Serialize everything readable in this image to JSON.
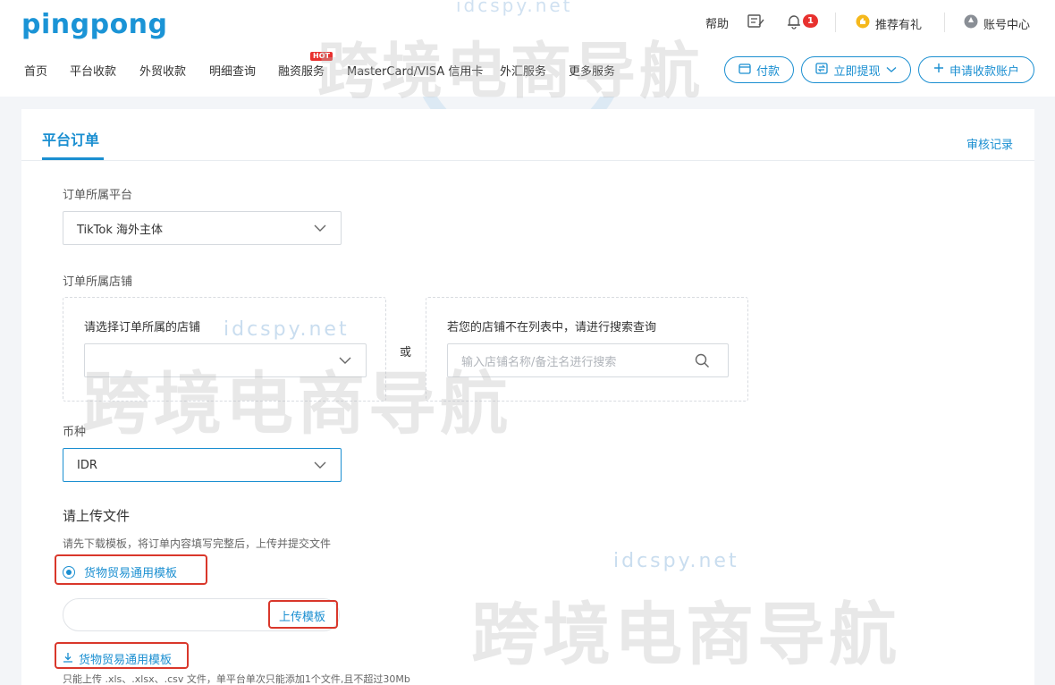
{
  "brand": {
    "logo": "pingpong",
    "accent": "#1b8fd1",
    "alert": "#e8312f"
  },
  "header": {
    "help": "帮助",
    "notif_count": "1",
    "referral": "推荐有礼",
    "account": "账号中心",
    "nav": [
      "首页",
      "平台收款",
      "外贸收款",
      "明细查询",
      "融资服务",
      "MasterCard/VISA 信用卡",
      "外汇服务",
      "更多服务"
    ],
    "hot_label": "HOT",
    "buttons": {
      "pay": "付款",
      "withdraw": "立即提现",
      "apply": "申请收款账户"
    }
  },
  "page": {
    "tab_title": "平台订单",
    "audit_link": "审核记录",
    "platform": {
      "label": "订单所属平台",
      "value": "TikTok 海外主体"
    },
    "store": {
      "label": "订单所属店铺",
      "select_title": "请选择订单所属的店铺",
      "or": "或",
      "search_title": "若您的店铺不在列表中，请进行搜索查询",
      "search_placeholder": "输入店铺名称/备注名进行搜索"
    },
    "currency": {
      "label": "币种",
      "value": "IDR"
    },
    "upload": {
      "title": "请上传文件",
      "hint": "请先下载模板，将订单内容填写完整后，上传并提交文件",
      "template_option": "货物贸易通用模板",
      "upload_button": "上传模板",
      "download_link": "货物贸易通用模板",
      "footnote": "只能上传 .xls、.xlsx、.csv 文件，单平台单次只能添加1个文件,且不超过30Mb"
    }
  },
  "watermark": {
    "domain": "idcspy.net",
    "text": "跨境电商导航"
  }
}
